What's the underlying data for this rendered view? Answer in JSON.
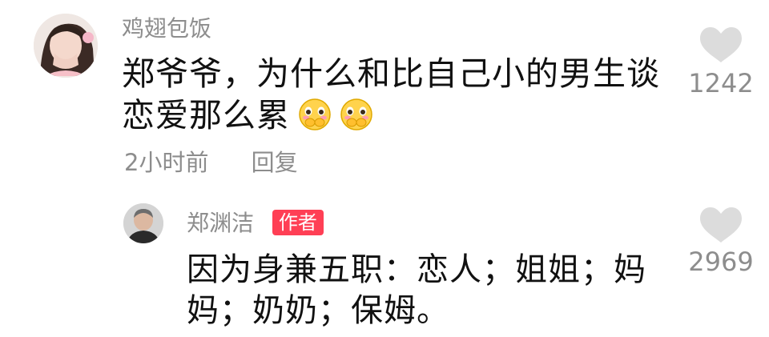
{
  "comment": {
    "username": "鸡翅包饭",
    "text": "郑爷爷，为什么和比自己小的男生谈恋爱那么累",
    "emojis": [
      "shy-hands-over-mouth-emoji",
      "shy-hands-over-mouth-emoji"
    ],
    "time": "2小时前",
    "reply_label": "回复",
    "like_count": "1242",
    "avatar_icon": "girl-avatar"
  },
  "reply": {
    "username": "郑渊洁",
    "author_badge": "作者",
    "text": "因为身兼五职：恋人；姐姐；妈妈；奶奶；保姆。",
    "like_count": "2969",
    "avatar_icon": "man-avatar"
  },
  "colors": {
    "text": "#111111",
    "secondary": "#8d8d8d",
    "badge": "#ff3f55",
    "heart": "#dcdcdc"
  }
}
